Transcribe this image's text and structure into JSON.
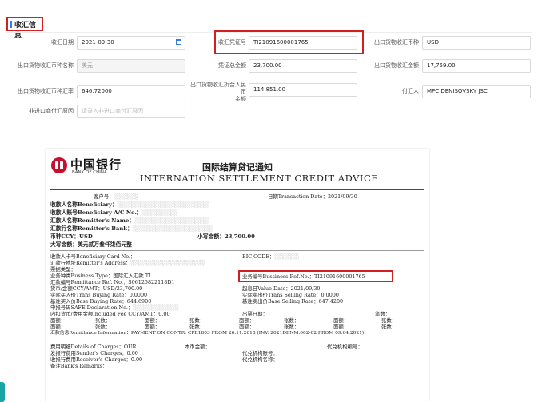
{
  "section": {
    "title": "收汇信息"
  },
  "form": {
    "receipt_date": {
      "label": "收汇日期",
      "value": "2021-09-30"
    },
    "voucher_no": {
      "label": "收汇凭证号",
      "value": "TI21091600001765"
    },
    "export_currency": {
      "label": "出口货物收汇币种",
      "value": "USD"
    },
    "export_currency_name": {
      "label": "出口货物收汇币种名称",
      "value": "美元"
    },
    "voucher_total": {
      "label": "凭证总金额",
      "value": "23,700.00"
    },
    "export_amount": {
      "label": "出口货物收汇金额",
      "value": "17,759.00"
    },
    "export_rate": {
      "label": "出口货物收汇币种汇率",
      "value": "646.72000"
    },
    "rmb_amount": {
      "label_line1": "出口货物收汇折合人民币",
      "label_line2": "金额",
      "value": "114,851.00"
    },
    "payer": {
      "label": "付汇人",
      "value": "MPC DENISOVSKY JSC"
    },
    "non_import_reason": {
      "label": "非进口商付汇原因",
      "placeholder": "请录入非进口商付汇原因"
    }
  },
  "advice": {
    "bank_cn": "中国银行",
    "bank_en": "BANK OF CHINA",
    "title_cn": "国际结算贷记通知",
    "title_en": "INTERNATION SETTLEMENT CREDIT ADVICE",
    "customer_no": "客户号：",
    "txn_date": "日期Transaction Date：2021/09/30",
    "beneficiary": "收款人名称Beneficiary：",
    "beneficiary_ac": "收款人账号Beneficiary A/C No.：",
    "remitter_name": "汇款人名称Remitter's Name：",
    "remitter_bank": "汇款行名称Remitter's Bank：",
    "currency": "币种CCY：USD",
    "amount_small": "小写金额：23,700.00",
    "amount_big": "大写金额：美元贰万叁仟柒佰元整",
    "card_no": "收款人卡号Beneficiary Card No.：",
    "bic": "BIC CODE：",
    "remitter_addr": "汇款行地址Remitter's Address：",
    "bill_type": "票据类型：",
    "business_type": "业务种类Business Type：国际汇入汇款  TI",
    "business_ref": "业务编号Bussiness Ref.No.：TI21091600001765",
    "remit_ref": "汇款编号Remittance Ref. No.：S06125822118D1",
    "ccy_amt": "货币/金额CCY/AMT：USD/23,700.00",
    "value_date": "起息日Value Date：2021/09/30",
    "buy_rate": "实际买入价Trans Buying Rate：0.0000",
    "sell_rate": "实际卖出价Trans Selling Rate：0.0000",
    "base_buy": "基准买入价Base Buying Rate：644.6900",
    "base_sell": "基准卖出价Base Selling Rate：647.4200",
    "safe_decl": "申报号码SAFE Declaration No.：",
    "fee_included": "内扣货币/费用金额Included Fee CCY/AMT：0.00",
    "export_date": "出票日期：",
    "count_label": "笔数：",
    "face_amt": "面额：",
    "sheets": "张数：",
    "remit_info": "汇款信息Remittance Information：PAYMENT ON CONTR. CPE1803 FROM 26.11.2018 (INV. 2021DENM.002-02 FROM 09.04.2021)",
    "charges": "费用明细Details of Charges：OUR",
    "local_amt": "本币金额：",
    "agent_no": "代兑机构编号：",
    "sender_charges": "发报行费用Sender's Charges：0.00",
    "agent_acct": "代兑机构账号：",
    "receiver_charges": "收报行费用Receiver's Charges：0.00",
    "agent_name": "代兑机构名称：",
    "remarks": "备注Bank's Remarks："
  },
  "colors": {
    "highlight": "#d21f1f",
    "accent": "#2e7cf6",
    "bank_red": "#c8102e"
  }
}
